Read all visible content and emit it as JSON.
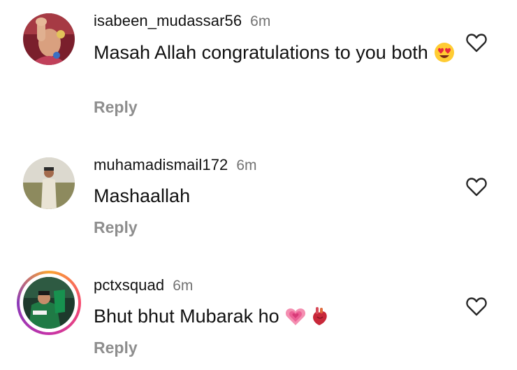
{
  "comments": [
    {
      "username": "isabeen_mudassar56",
      "time": "6m",
      "text": "Masah Allah congratulations to you both",
      "emojis": [
        "heart-eyes-emoji"
      ],
      "reply_label": "Reply"
    },
    {
      "username": "muhamadismail172",
      "time": "6m",
      "text": "Mashaallah",
      "emojis": [],
      "reply_label": "Reply"
    },
    {
      "username": "pctxsquad",
      "time": "6m",
      "text": "Bhut bhut Mubarak ho",
      "emojis": [
        "growing-heart-emoji",
        "anatomical-heart-emoji"
      ],
      "reply_label": "Reply",
      "has_story_ring": true
    }
  ],
  "icons": {
    "like": "heart-outline-icon"
  },
  "colors": {
    "meta_gray": "#737373",
    "reply_gray": "#8e8e8e",
    "story_ring": [
      "#f9a431",
      "#f74b6f",
      "#c532a8"
    ]
  }
}
